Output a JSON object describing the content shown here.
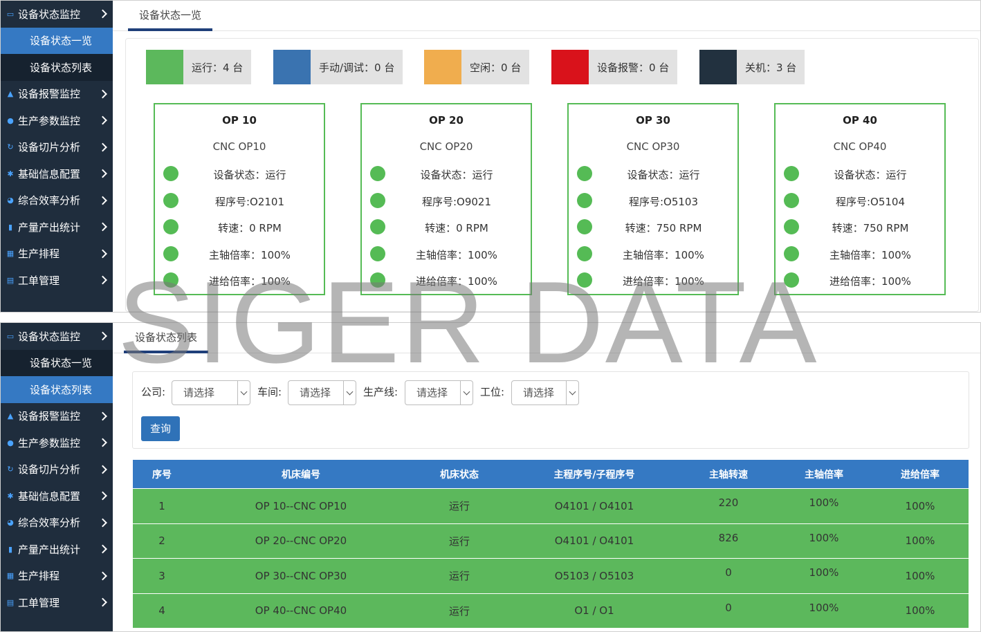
{
  "sidebar": {
    "items": [
      {
        "icon": "monitor-icon",
        "label": "设备状态监控"
      },
      {
        "icon": "bell-icon",
        "label": "设备报警监控"
      },
      {
        "icon": "user-icon",
        "label": "生产参数监控"
      },
      {
        "icon": "refresh-icon",
        "label": "设备切片分析"
      },
      {
        "icon": "gear-icon",
        "label": "基础信息配置"
      },
      {
        "icon": "pie-chart-icon",
        "label": "综合效率分析"
      },
      {
        "icon": "bar-chart-icon",
        "label": "产量产出统计"
      },
      {
        "icon": "calendar-icon",
        "label": "生产排程"
      },
      {
        "icon": "clipboard-icon",
        "label": "工单管理"
      }
    ],
    "sub_items": [
      "设备状态一览",
      "设备状态列表"
    ]
  },
  "screen1": {
    "tab_label": "设备状态一览",
    "legend": [
      {
        "text": "运行：4 台",
        "color": "#5cb85c"
      },
      {
        "text": "手动/调试：0 台",
        "color": "#3a73b0"
      },
      {
        "text": "空闲：0 台",
        "color": "#f0ad4e"
      },
      {
        "text": "设备报警：0 台",
        "color": "#d9121b"
      },
      {
        "text": "关机：3 台",
        "color": "#22313f"
      }
    ],
    "cards": [
      {
        "title": "OP 10",
        "name": "CNC OP10",
        "rows": [
          "设备状态：运行",
          "程序号:O2101",
          "转速：0 RPM",
          "主轴倍率：100%",
          "进给倍率：100%"
        ]
      },
      {
        "title": "OP 20",
        "name": "CNC OP20",
        "rows": [
          "设备状态：运行",
          "程序号:O9021",
          "转速：0 RPM",
          "主轴倍率：100%",
          "进给倍率：100%"
        ]
      },
      {
        "title": "OP 30",
        "name": "CNC OP30",
        "rows": [
          "设备状态：运行",
          "程序号:O5103",
          "转速：750 RPM",
          "主轴倍率：100%",
          "进给倍率：100%"
        ]
      },
      {
        "title": "OP 40",
        "name": "CNC OP40",
        "rows": [
          "设备状态：运行",
          "程序号:O5104",
          "转速：750 RPM",
          "主轴倍率：100%",
          "进给倍率：100%"
        ]
      }
    ],
    "status_color": "#5cb85c"
  },
  "screen2": {
    "tab_label": "设备状态列表",
    "filters": [
      {
        "label": "公司:",
        "value": "请选择"
      },
      {
        "label": "车间:",
        "value": "请选择"
      },
      {
        "label": "生产线:",
        "value": "请选择"
      },
      {
        "label": "工位:",
        "value": "请选择"
      }
    ],
    "query_label": "查询",
    "table": {
      "headers": [
        "序号",
        "机床编号",
        "机床状态",
        "主程序号/子程序号",
        "主轴转速",
        "主轴倍率",
        "进给倍率"
      ],
      "rows": [
        [
          "1",
          "OP 10--CNC OP10",
          "运行",
          "O4101 / O4101",
          "220",
          "100%",
          "100%"
        ],
        [
          "2",
          "OP 20--CNC OP20",
          "运行",
          "O4101 / O4101",
          "826",
          "100%",
          "100%"
        ],
        [
          "3",
          "OP 30--CNC OP30",
          "运行",
          "O5103 / O5103",
          "0",
          "100%",
          "100%"
        ],
        [
          "4",
          "OP 40--CNC OP40",
          "运行",
          "O1 / O1",
          "0",
          "100%",
          "100%"
        ]
      ]
    },
    "header_color": "#3579c3",
    "row_color": "#5cb85c"
  },
  "watermark": "SIGER DATA"
}
